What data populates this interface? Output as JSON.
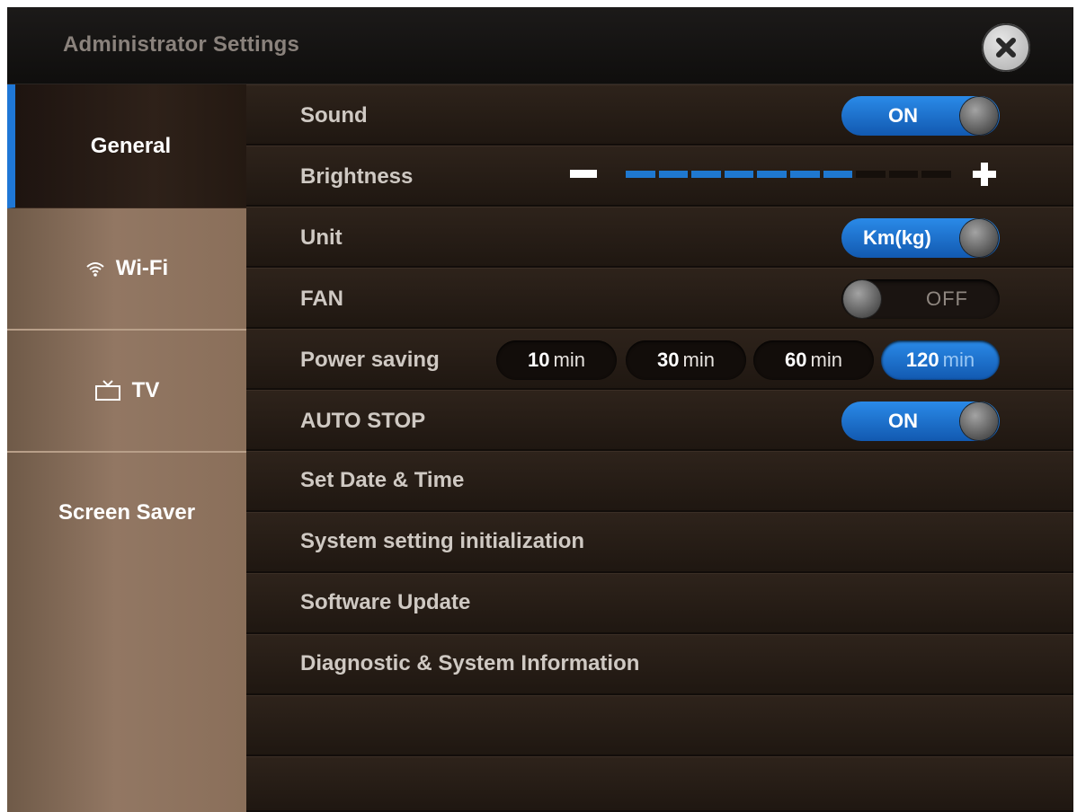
{
  "window": {
    "title": "Administrator Settings"
  },
  "sidebar": {
    "items": [
      {
        "label": "General",
        "active": true
      },
      {
        "label": "Wi-Fi",
        "icon": "wifi-icon"
      },
      {
        "label": "TV",
        "icon": "tv-icon"
      },
      {
        "label": "Screen Saver"
      }
    ]
  },
  "settings": {
    "sound": {
      "label": "Sound",
      "state": "ON"
    },
    "brightness": {
      "label": "Brightness",
      "level": 7,
      "max": 10
    },
    "unit": {
      "label": "Unit",
      "value": "Km(kg)"
    },
    "fan": {
      "label": "FAN",
      "state": "OFF"
    },
    "power_saving": {
      "label": "Power saving",
      "options": [
        {
          "num": "10",
          "unit": "min"
        },
        {
          "num": "30",
          "unit": "min"
        },
        {
          "num": "60",
          "unit": "min"
        },
        {
          "num": "120",
          "unit": "min"
        }
      ],
      "selected": "120"
    },
    "auto_stop": {
      "label": "AUTO STOP",
      "state": "ON"
    },
    "set_date_time": {
      "label": "Set Date & Time"
    },
    "system_init": {
      "label": "System setting initialization"
    },
    "software_update": {
      "label": "Software Update"
    },
    "diagnostic": {
      "label": "Diagnostic & System Information"
    }
  },
  "colors": {
    "accent": "#1f77d6",
    "background": "#1d1612",
    "sidebar": "#8a6f5a"
  }
}
